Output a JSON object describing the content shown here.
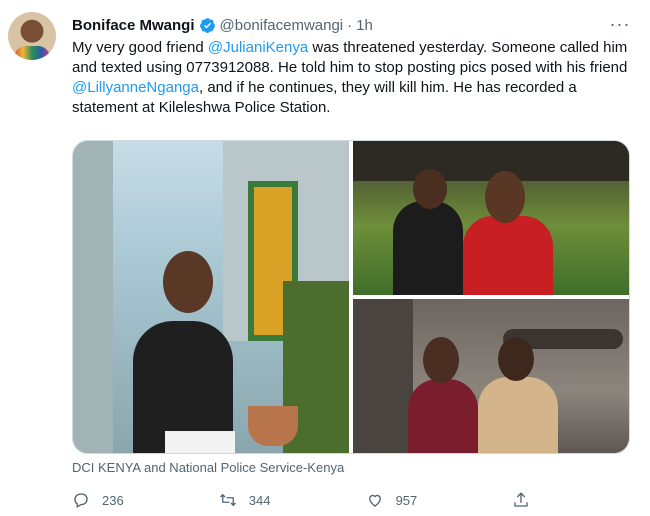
{
  "tweet": {
    "author_name": "Boniface Mwangi",
    "handle": "@bonifacemwangi",
    "separator": "·",
    "time": "1h",
    "more_glyph": "···",
    "text_parts": [
      {
        "text": "My very good friend ",
        "type": "plain"
      },
      {
        "text": "@JulianiKenya",
        "type": "mention"
      },
      {
        "text": " was threatened yesterday. Someone called him and texted using 0773912088. He told him to stop posting pics posed with his friend ",
        "type": "plain"
      },
      {
        "text": "@LillyanneNganga",
        "type": "mention"
      },
      {
        "text": ", and if he continues, they will kill him. He has recorded a statement at Kileleshwa Police Station.",
        "type": "plain"
      }
    ],
    "media_caption": "DCI KENYA and National Police Service-Kenya",
    "actions": {
      "replies": "236",
      "retweets": "344",
      "likes": "957"
    }
  },
  "colors": {
    "accent": "#1d9bf0",
    "text": "#0f1419",
    "secondary": "#536471"
  },
  "icons": {
    "verified": "verified-badge-icon",
    "reply": "reply-icon",
    "retweet": "retweet-icon",
    "like": "heart-icon",
    "share": "share-icon"
  }
}
